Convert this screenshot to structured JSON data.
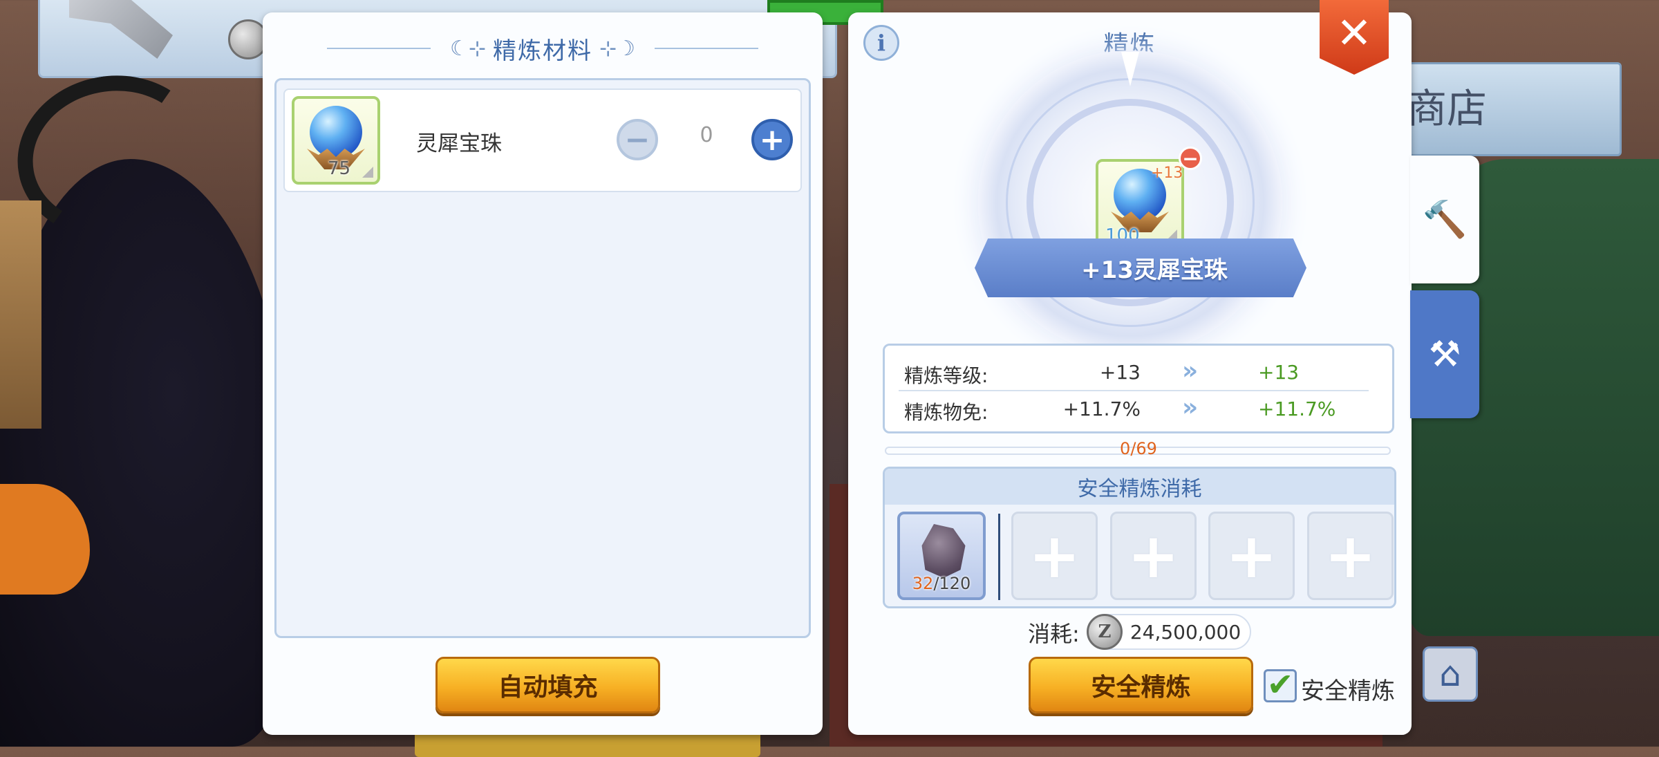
{
  "background": {
    "shop_text": "商店"
  },
  "material_panel": {
    "title": "精炼材料",
    "items": [
      {
        "name": "灵犀宝珠",
        "count": "75",
        "quantity": "0",
        "icon": "crystal-orb-icon"
      }
    ],
    "minus_symbol": "−",
    "plus_symbol": "+",
    "autofill_label": "自动填充"
  },
  "refine_panel": {
    "title": "精炼",
    "info_symbol": "i",
    "close_symbol": "✕",
    "item": {
      "name": "+13灵犀宝珠",
      "count": "100",
      "level": "+13",
      "icon": "crystal-orb-icon"
    },
    "remove_symbol": "−",
    "stats": [
      {
        "label": "精炼等级:",
        "current": "+13",
        "next": "+13"
      },
      {
        "label": "精炼物免:",
        "current": "+11.7%",
        "next": "+11.7%"
      }
    ],
    "arrow_symbol": "»",
    "progress": {
      "text": "0/69",
      "fraction": 0.0
    },
    "safe_cost": {
      "title": "安全精炼消耗",
      "material": {
        "have": "32",
        "need": "/120",
        "icon": "ore-rock-icon"
      },
      "empty_slot_symbol": "+"
    },
    "zeny_label": "消耗:",
    "zeny_coin_symbol": "Z",
    "zeny_value": "24,500,000",
    "safe_refine_label": "安全精炼",
    "safe_refine_check_symbol": "✔",
    "safe_refine_check_label": "安全精炼"
  },
  "side_tabs": [
    {
      "icon": "hammer-icon",
      "active": true
    },
    {
      "icon": "hammer-plus-icon",
      "active": false
    }
  ],
  "colors": {
    "accent_blue": "#3f6aa8",
    "gold_button": "#f7b024",
    "close_red": "#e24e28",
    "progress_orange": "#e0641e",
    "stat_green": "#4a9a22"
  }
}
